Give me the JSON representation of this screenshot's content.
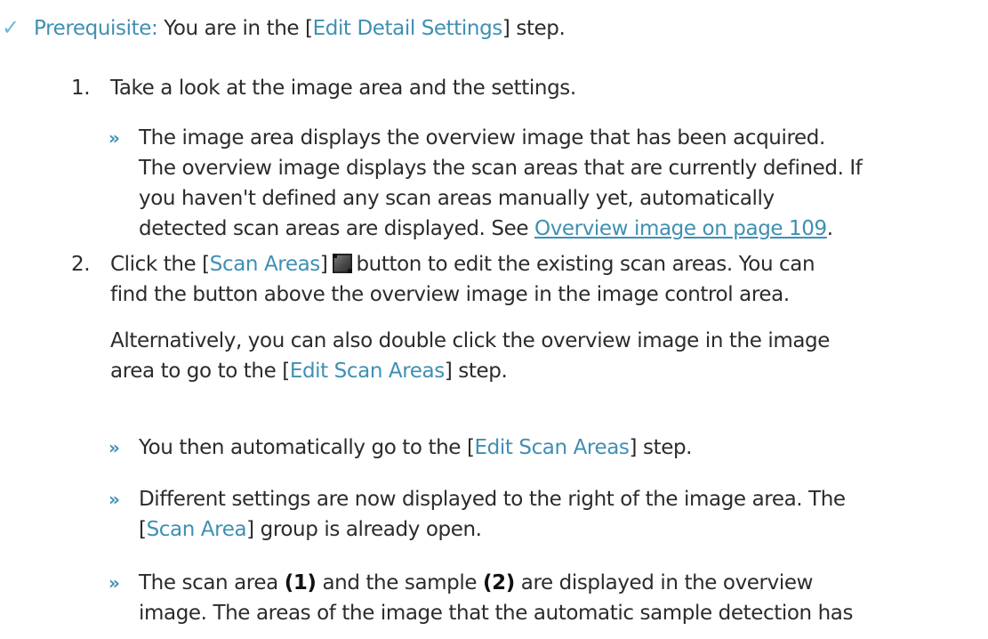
{
  "prereq": {
    "check_icon": "checkmark-icon",
    "label": "Prerequisite:",
    "text_a": " You are in the [",
    "ui_edit_detail": "Edit Detail Settings",
    "text_b": "] step."
  },
  "step1": {
    "number": "1.",
    "text": "Take a look at the image area and the settings.",
    "result1_l1": "The image area displays the overview image that has been acquired.",
    "result1_l2": "The overview image displays the scan areas that are currently defined. If",
    "result1_l3": "you haven't defined any scan areas manually yet, automatically",
    "result1_l4a": "detected scan areas are displayed. See ",
    "result1_link": "Overview image on page 109",
    "result1_l4b": "."
  },
  "step2": {
    "number": "2.",
    "l1a": "Click the [",
    "ui_scan_areas": "Scan Areas",
    "l1b": "]",
    "button_icon": "scan-areas-icon",
    "l1c": "button to edit the existing scan areas. You can",
    "l2": "find the button above the overview image in the image control area.",
    "alt_l1": "Alternatively, you can also double click the overview image in the image",
    "alt_l2a": "area to go to the [",
    "ui_edit_scan_areas": "Edit Scan Areas",
    "alt_l2b": "] step.",
    "r1a": "You then automatically go to the [",
    "r1_ui": "Edit Scan Areas",
    "r1b": "] step.",
    "r2_l1": "Different settings are now displayed to the right of the image area. The",
    "r2_l2a": "[",
    "r2_ui": "Scan Area",
    "r2_l2b": "] group is already open.",
    "r3_l1a": "The scan area ",
    "r3_b1": "(1)",
    "r3_l1b": " and the sample ",
    "r3_b2": "(2)",
    "r3_l1c": " are displayed in the overview",
    "r3_l2": "image. The areas of the image that the automatic sample detection has"
  },
  "result_marker": "»"
}
